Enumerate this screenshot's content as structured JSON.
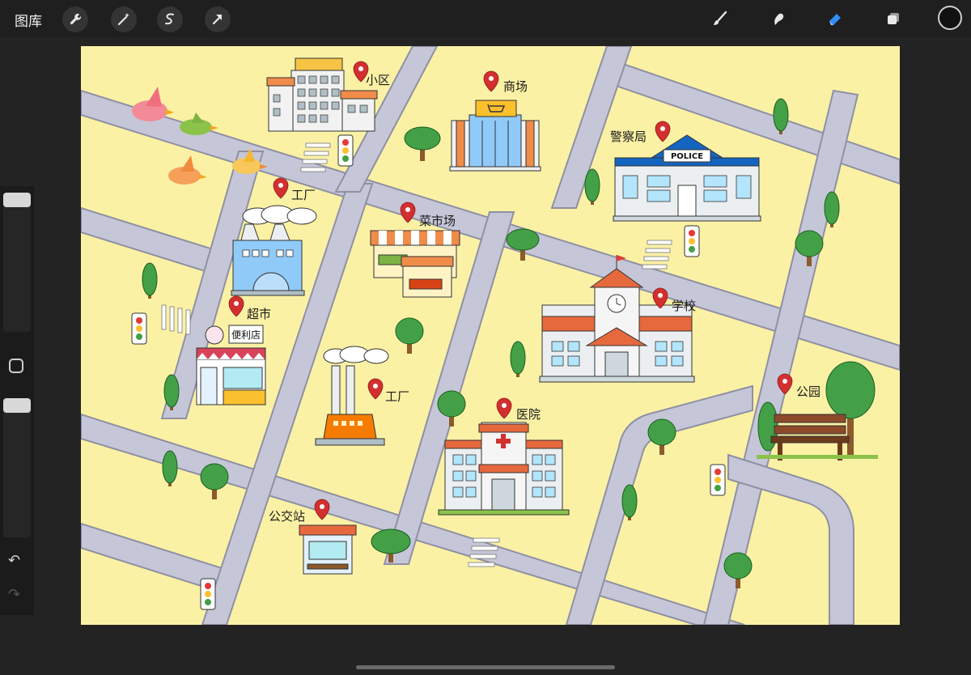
{
  "toolbar": {
    "gallery_label": "图库",
    "left_tools": [
      "wrench-icon",
      "magic-wand-icon",
      "selection-icon",
      "transform-arrow-icon"
    ],
    "right_tools": [
      "brush-icon",
      "smudge-icon",
      "eraser-icon",
      "layers-icon",
      "color-icon"
    ],
    "active_tool": "eraser-icon",
    "active_color": "#111111"
  },
  "map": {
    "labels": {
      "residential": "小区",
      "mall": "商场",
      "police_station": "警察局",
      "police_sign": "POLICE",
      "factory_top": "工厂",
      "market": "菜市场",
      "supermarket": "超市",
      "store_sign": "便利店",
      "school": "学校",
      "factory_bottom": "工厂",
      "hospital": "医院",
      "park": "公园",
      "bus_stop": "公交站"
    },
    "colors": {
      "ground": "#fbf1a5",
      "road": "#c5c7d8",
      "pin": "#d32f2f"
    }
  }
}
